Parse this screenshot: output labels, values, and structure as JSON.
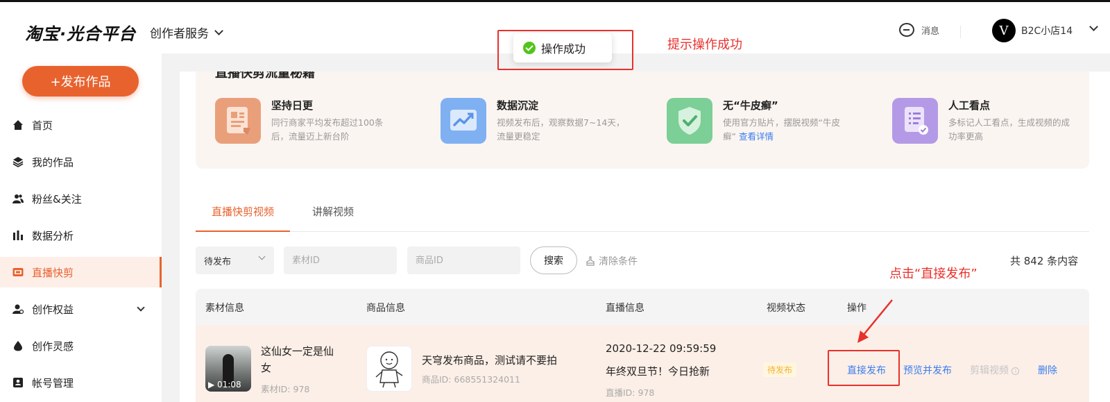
{
  "header": {
    "logo": "淘宝·光合平台",
    "nav_creator": "创作者服务",
    "messages_label": "消息",
    "avatar_text": "V",
    "user_name": "B2C小店14"
  },
  "sidebar": {
    "publish_button": "+发布作品",
    "items": [
      {
        "label": "首页",
        "icon": "home-icon"
      },
      {
        "label": "我的作品",
        "icon": "layers-icon"
      },
      {
        "label": "粉丝&关注",
        "icon": "users-icon"
      },
      {
        "label": "数据分析",
        "icon": "bar-chart-icon"
      },
      {
        "label": "直播快剪",
        "icon": "video-icon"
      },
      {
        "label": "创作权益",
        "icon": "user-badge-icon"
      },
      {
        "label": "创作灵感",
        "icon": "drop-icon"
      },
      {
        "label": "帐号管理",
        "icon": "id-card-icon"
      }
    ],
    "active_index": 4
  },
  "tips": {
    "title": "直播快剪流量秘籍",
    "cards": [
      {
        "title": "坚持日更",
        "desc": "同行商家平均发布超过100条后，流量迈上新台阶",
        "link": "",
        "color": "#e9a07a"
      },
      {
        "title": "数据沉淀",
        "desc": "视频发布后，观察数据7~14天，流量更稳定",
        "link": "",
        "color": "#7fb0f2"
      },
      {
        "title": "无“牛皮癣”",
        "desc": "使用官方贴片，摆脱视频“牛皮癣”",
        "link": "查看详情",
        "color": "#7ccf96"
      },
      {
        "title": "人工看点",
        "desc": "多标记人工看点，生成视频的成功率更高",
        "link": "",
        "color": "#b49ae6"
      }
    ]
  },
  "tabs": [
    "直播快剪视频",
    "讲解视频"
  ],
  "filters": {
    "status_value": "待发布",
    "material_placeholder": "素材ID",
    "product_placeholder": "商品ID",
    "search_label": "搜索",
    "clear_label": "清除条件",
    "count_text": "共 842 条内容"
  },
  "table": {
    "headers": [
      "素材信息",
      "商品信息",
      "直播信息",
      "视频状态",
      "操作"
    ],
    "rows": [
      {
        "material_title": "这仙女一定是仙女",
        "duration": "01:08",
        "material_id": "素材ID: 978",
        "product_title": "天穹发布商品，测试请不要拍",
        "product_id": "商品ID: 668551324011",
        "live_time": "2020-12-22 09:59:59",
        "live_title": "年终双旦节！今日抢新",
        "live_id": "直播ID: 978",
        "status": "待发布",
        "actions": [
          "直接发布",
          "预览并发布",
          "剪辑视频",
          "删除"
        ]
      }
    ]
  },
  "toast": {
    "text": "操作成功"
  },
  "annotations": {
    "toast_note": "提示操作成功",
    "click_note": "点击“直接发布”"
  },
  "colors": {
    "brand": "#e8622e",
    "link": "#3b7df0",
    "annotation": "#e8312c",
    "success": "#52c41a"
  }
}
